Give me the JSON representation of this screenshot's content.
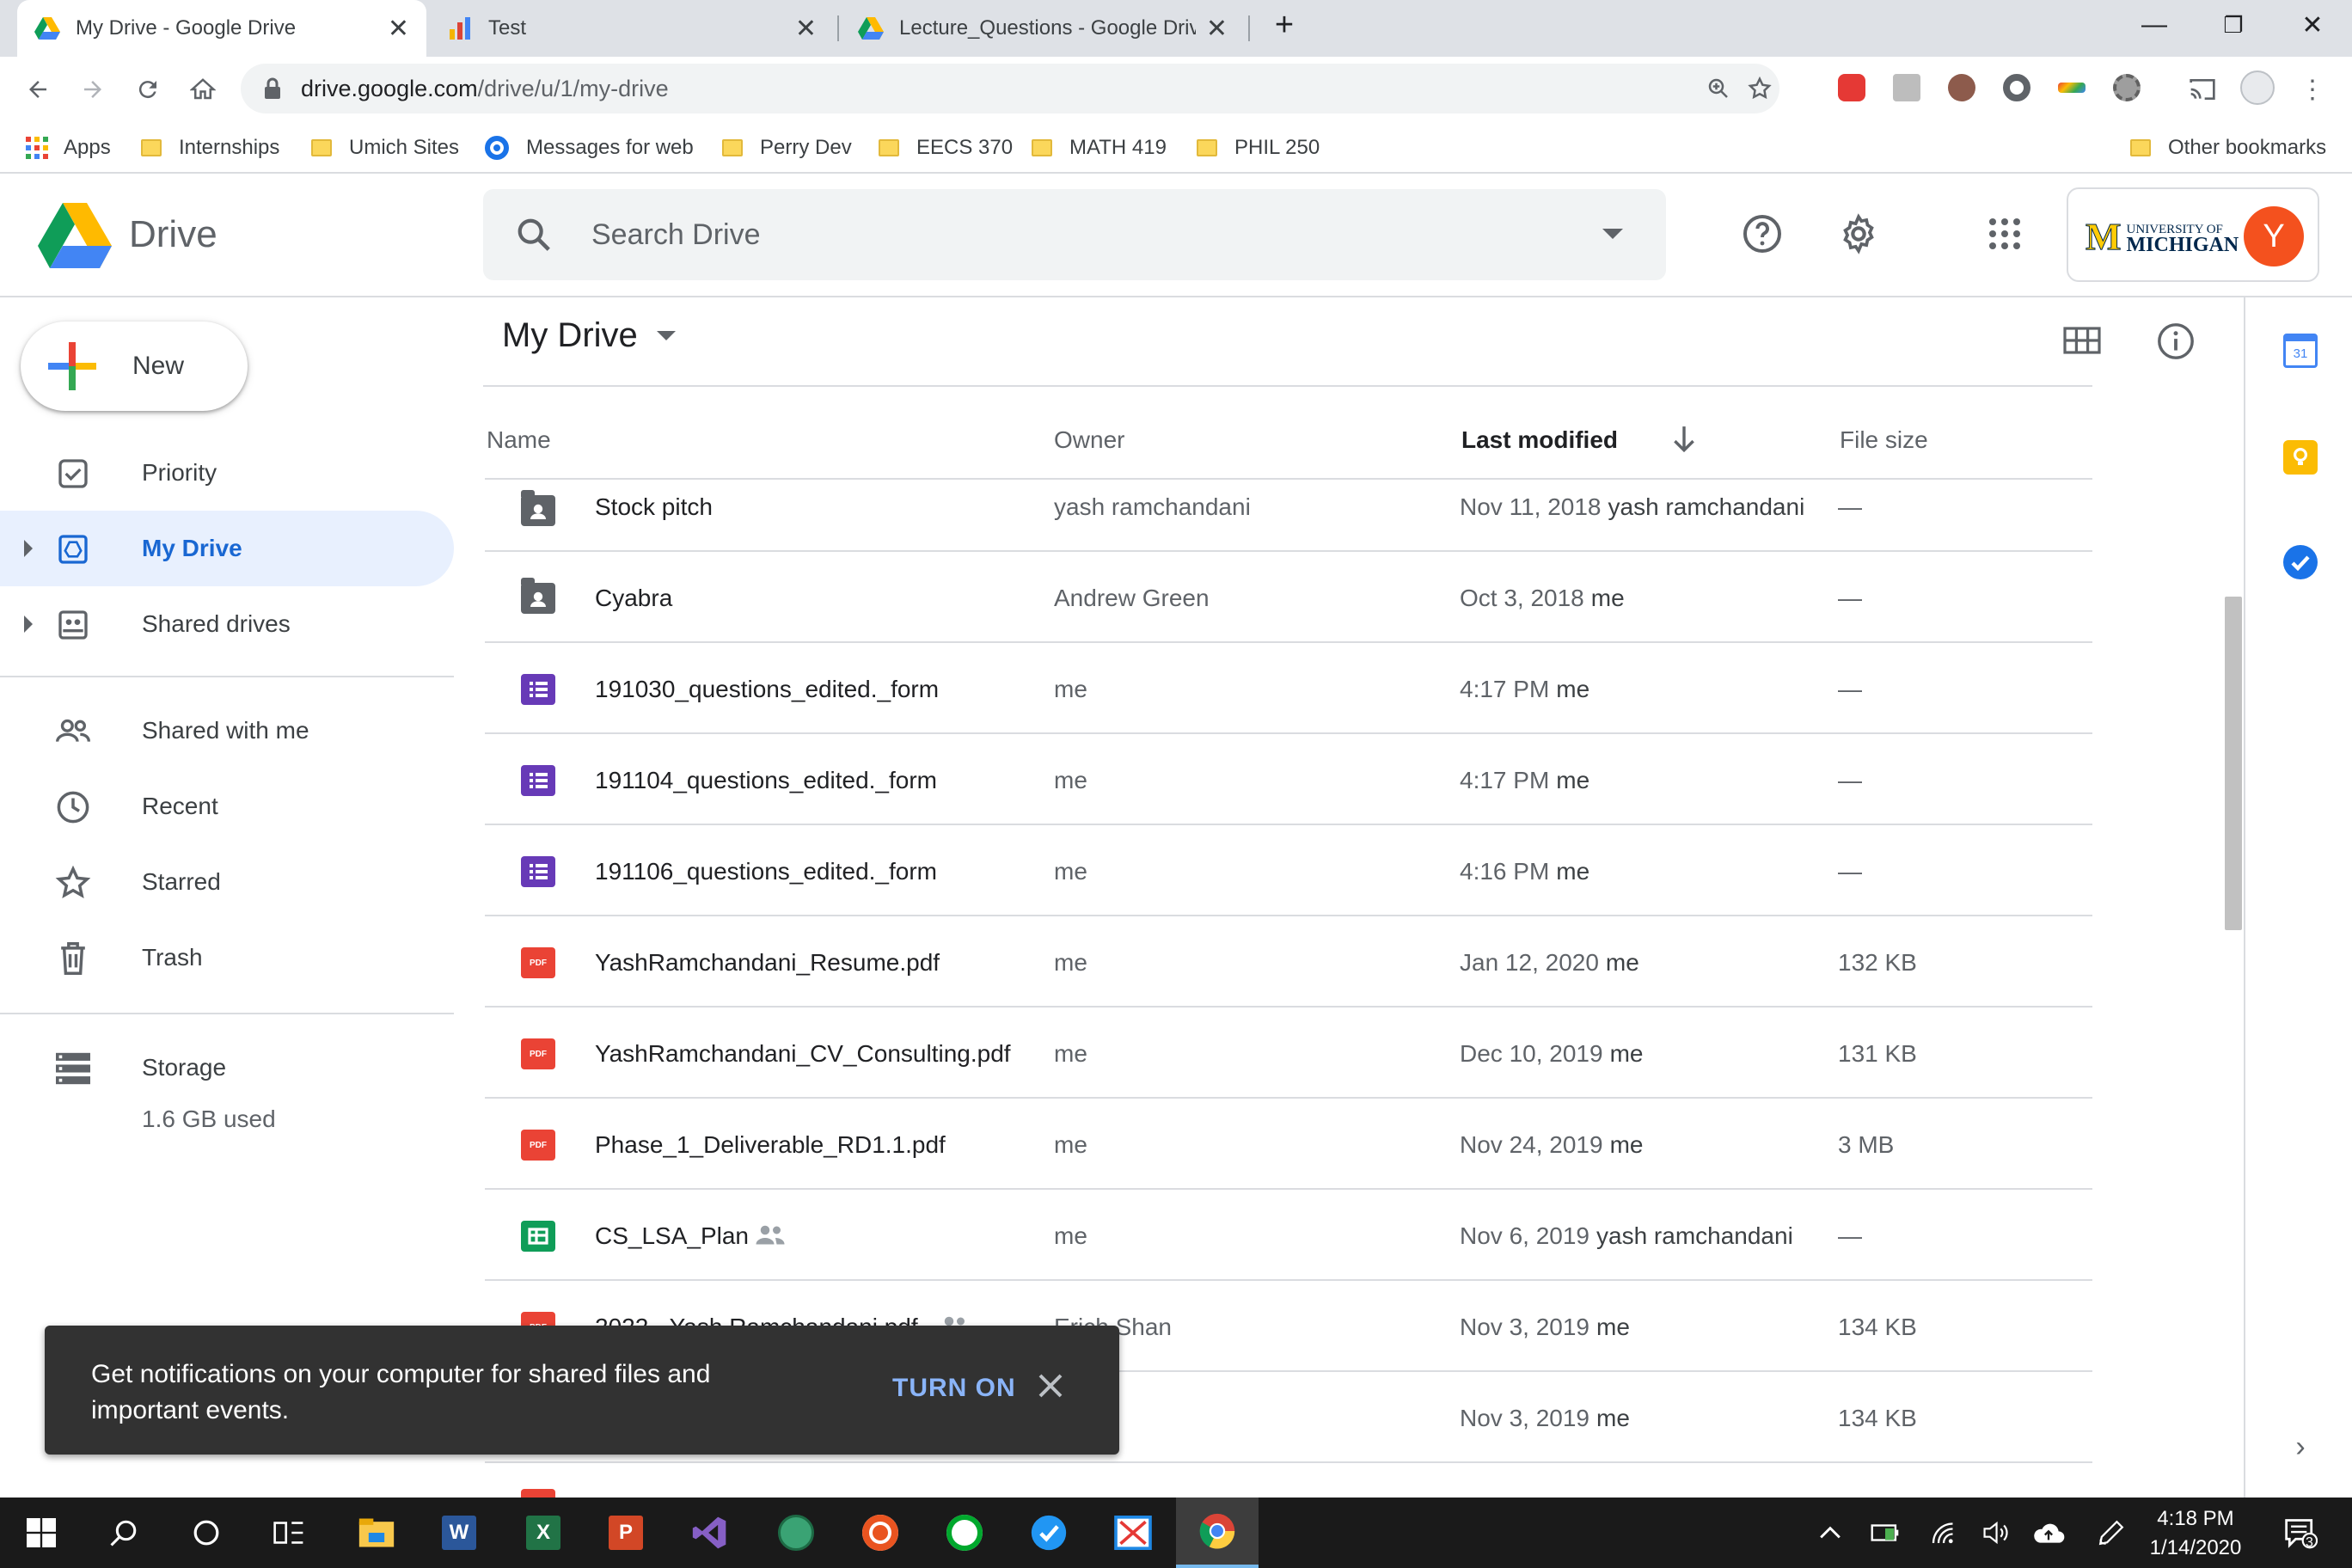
{
  "browser": {
    "tabs": [
      {
        "title": "My Drive - Google Drive",
        "active": true
      },
      {
        "title": "Test",
        "active": false
      },
      {
        "title": "Lecture_Questions - Google Drive",
        "active": false
      }
    ],
    "url_domain": "drive.google.com",
    "url_path": "/drive/u/1/my-drive",
    "bookmarks": [
      {
        "label": "Apps",
        "icon": "apps-grid-icon"
      },
      {
        "label": "Internships",
        "icon": "folder-icon"
      },
      {
        "label": "Umich Sites",
        "icon": "folder-icon"
      },
      {
        "label": "Messages for web",
        "icon": "messages-icon"
      },
      {
        "label": "Perry Dev",
        "icon": "folder-icon"
      },
      {
        "label": "EECS 370",
        "icon": "folder-icon"
      },
      {
        "label": "MATH 419",
        "icon": "folder-icon"
      },
      {
        "label": "PHIL 250",
        "icon": "folder-icon"
      }
    ],
    "other_bookmarks": "Other bookmarks"
  },
  "drive": {
    "app_name": "Drive",
    "search_placeholder": "Search Drive",
    "account_initial": "Y",
    "org_logo_text_top": "UNIVERSITY OF",
    "org_logo_text_bottom": "MICHIGAN",
    "new_label": "New",
    "nav": [
      {
        "label": "Priority",
        "icon": "priority-check-icon"
      },
      {
        "label": "My Drive",
        "icon": "my-drive-icon",
        "active": true
      },
      {
        "label": "Shared drives",
        "icon": "shared-drives-icon"
      },
      {
        "label": "Shared with me",
        "icon": "people-icon"
      },
      {
        "label": "Recent",
        "icon": "clock-icon"
      },
      {
        "label": "Starred",
        "icon": "star-icon"
      },
      {
        "label": "Trash",
        "icon": "trash-icon"
      },
      {
        "label": "Storage",
        "icon": "storage-icon"
      }
    ],
    "storage_used": "1.6 GB used",
    "breadcrumb": "My Drive",
    "columns": {
      "name": "Name",
      "owner": "Owner",
      "last_modified": "Last modified",
      "file_size": "File size"
    },
    "files": [
      {
        "name": "Stock pitch",
        "type": "shared-folder",
        "owner": "yash ramchandani",
        "modified": "Nov 11, 2018",
        "modified_by": "yash ramchandani",
        "size": "—"
      },
      {
        "name": "Cyabra",
        "type": "shared-folder",
        "owner": "Andrew Green",
        "modified": "Oct 3, 2018",
        "modified_by": "me",
        "size": "—"
      },
      {
        "name": "191030_questions_edited._form",
        "type": "form",
        "owner": "me",
        "modified": "4:17 PM",
        "modified_by": "me",
        "size": "—"
      },
      {
        "name": "191104_questions_edited._form",
        "type": "form",
        "owner": "me",
        "modified": "4:17 PM",
        "modified_by": "me",
        "size": "—"
      },
      {
        "name": "191106_questions_edited._form",
        "type": "form",
        "owner": "me",
        "modified": "4:16 PM",
        "modified_by": "me",
        "size": "—"
      },
      {
        "name": "YashRamchandani_Resume.pdf",
        "type": "pdf",
        "owner": "me",
        "modified": "Jan 12, 2020",
        "modified_by": "me",
        "size": "132 KB"
      },
      {
        "name": "YashRamchandani_CV_Consulting.pdf",
        "type": "pdf",
        "owner": "me",
        "modified": "Dec 10, 2019",
        "modified_by": "me",
        "size": "131 KB"
      },
      {
        "name": "Phase_1_Deliverable_RD1.1.pdf",
        "type": "pdf",
        "owner": "me",
        "modified": "Nov 24, 2019",
        "modified_by": "me",
        "size": "3 MB"
      },
      {
        "name": "CS_LSA_Plan",
        "type": "sheet",
        "shared": true,
        "owner": "me",
        "modified": "Nov 6, 2019",
        "modified_by": "yash ramchandani",
        "size": "—"
      },
      {
        "name": "2022 - Yash Ramchandani.pdf",
        "type": "pdf",
        "shared": true,
        "owner": "Erich Shan",
        "modified": "Nov 3, 2019",
        "modified_by": "me",
        "size": "134 KB"
      },
      {
        "name": "",
        "type": "pdf",
        "owner": "",
        "modified": "Nov 3, 2019",
        "modified_by": "me",
        "size": "134 KB"
      }
    ],
    "pdf_badge": "PDF",
    "snackbar": {
      "message": "Get notifications on your computer for shared files and important events.",
      "action": "TURN ON"
    },
    "side_panel_calendar_day": "31"
  },
  "taskbar": {
    "time": "4:18 PM",
    "date": "1/14/2020",
    "notification_count": "3"
  },
  "colors": {
    "accent_blue": "#1a73e8",
    "active_nav_bg": "#e8f0fe",
    "snackbar_bg": "#323232",
    "snackbar_action": "#8ab4f8",
    "avatar": "#f4511e"
  }
}
